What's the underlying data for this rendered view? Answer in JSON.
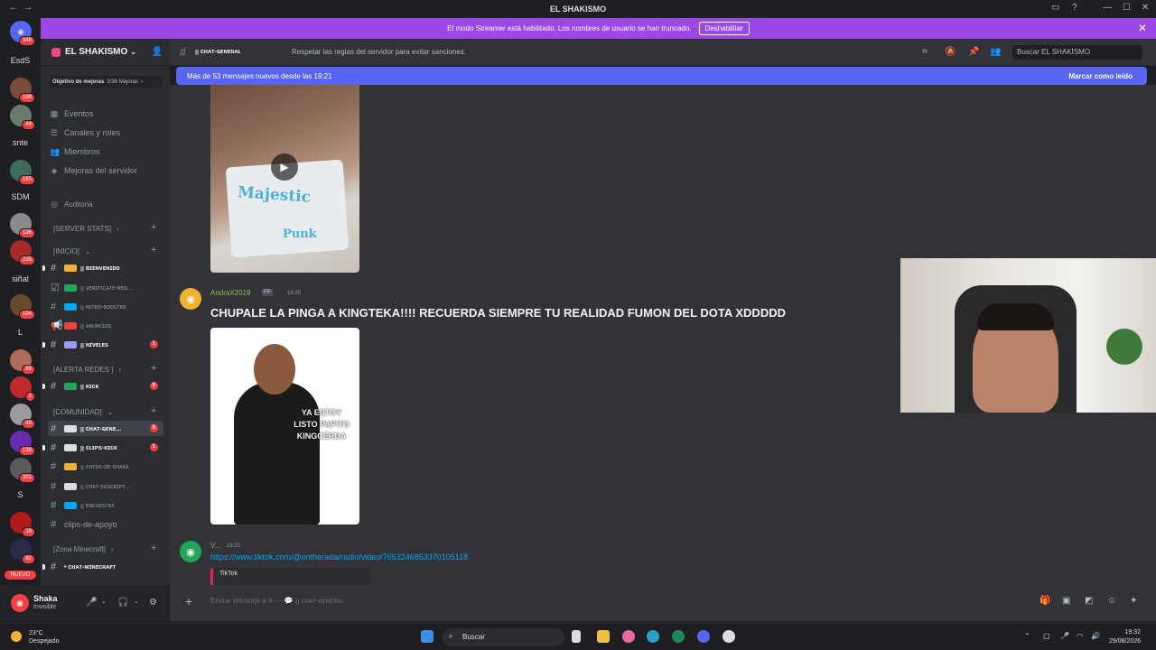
{
  "window": {
    "title": "EL SHAKISMO",
    "nav_back": "←",
    "nav_forward": "→"
  },
  "banner": {
    "text": "El modo Streamer está habilitado. Los nombres de usuario se han truncado.",
    "button": "Deshabilitar",
    "close": "✕"
  },
  "guilds": {
    "top_badge": "348",
    "items": [
      {
        "label": "EsdS",
        "badge": ""
      },
      {
        "label": "",
        "badge": "108"
      },
      {
        "label": "",
        "badge": "44"
      },
      {
        "label": "snte",
        "badge": ""
      },
      {
        "label": "",
        "badge": "165"
      },
      {
        "label": "SDM",
        "badge": ""
      },
      {
        "label": "",
        "badge": "136"
      },
      {
        "label": "",
        "badge": "235"
      },
      {
        "label": "siñal",
        "badge": ""
      },
      {
        "label": "",
        "badge": "104"
      },
      {
        "label": "L",
        "badge": ""
      },
      {
        "label": "",
        "badge": "89"
      },
      {
        "label": "",
        "badge": "2"
      },
      {
        "label": "",
        "badge": "46"
      },
      {
        "label": "",
        "badge": "138"
      },
      {
        "label": "",
        "badge": "301"
      },
      {
        "label": "S",
        "badge": ""
      },
      {
        "label": "",
        "badge": "19"
      },
      {
        "label": "",
        "badge": "82"
      }
    ],
    "new_label": "NUEVO"
  },
  "server": {
    "name": "EL SHAKISMO",
    "boost_label": "Objetivo de mejoras",
    "boost_count": "2/36 Mejoras",
    "menu": [
      "Eventos",
      "Canales y roles",
      "Miembros",
      "Mejoras del servidor"
    ],
    "audit": "Auditoria"
  },
  "categories": [
    {
      "label": "[SERVER STATS]"
    },
    {
      "label": "[INICIO]"
    },
    {
      "label": "[ALERTA REDES ]"
    },
    {
      "label": "[COMUNIDAD]"
    },
    {
      "label": "[Zona Minecraft]"
    }
  ],
  "channels": [
    {
      "label": "ꞁꞁ ʙɪᴇɴᴠᴇɴɪᴅᴏ",
      "badge": "",
      "color": "#f0b232"
    },
    {
      "label": "ꞁꞁ ᴠᴇʀɪꜰɪᴄᴀᴛᴇ-ʀᴇɢ...",
      "badge": "",
      "color": "#23a55a"
    },
    {
      "label": "ꞁꞁ ɴɪᴛʀᴏ-ʙᴏᴏsᴛᴇʀ",
      "badge": "",
      "color": "#00a8fc"
    },
    {
      "label": "ꞁꞁ ᴀɴᴜɴᴄɪᴏs",
      "badge": "",
      "color": "#f23f43"
    },
    {
      "label": "ꞁꞁ ɴɪᴠᴇʟᴇs",
      "badge": "1",
      "color": "#949cf7"
    },
    {
      "label": "ꞁꞁ ᴋɪᴄᴋ",
      "badge": "6",
      "color": "#23a55a"
    },
    {
      "label": "ꞁꞁ ᴄʜᴀᴛ-ɢᴇɴᴇ...",
      "badge": "5",
      "color": "#dbdee1"
    },
    {
      "label": "ꞁꞁ ᴄʟɪᴘs-ᴋɪᴄᴋ",
      "badge": "1",
      "color": "#dbdee1"
    },
    {
      "label": "ꞁꞁ ꜰᴏᴛᴏs-ᴅᴇ-sʜᴀᴋᴀ",
      "badge": "",
      "color": "#f0b232"
    },
    {
      "label": "ꞁꞁ ᴄʜᴀᴛ-sᴜsᴄʀɪᴘᴛ...",
      "badge": "",
      "color": "#dbdee1"
    },
    {
      "label": "ꞁꞁ ᴇɴᴄᴜᴇsᴛᴀs",
      "badge": "",
      "color": "#00a8fc"
    },
    {
      "label": "clips-de-apoyo",
      "badge": "",
      "color": ""
    },
    {
      "label": "• ᴄʜᴀᴛ-ᴍɪɴᴇᴄʀᴀꜰᴛ",
      "badge": "",
      "color": ""
    }
  ],
  "user": {
    "name": "Shaka",
    "status": "Invisible"
  },
  "channel_header": {
    "name": "ꞁꞁ ᴄʜᴀᴛ-ɢᴇɴᴇʀᴀʟ",
    "topic": "Respetar las reglas del servidor para evitar sanciones.",
    "search_placeholder": "Buscar EL SHAKISMO"
  },
  "new_messages": {
    "text": "Más de 53 mensajes nuevos desde las 19:21",
    "mark": "Marcar como leído"
  },
  "messages": [
    {
      "author": "AndraX2019",
      "role": "FP",
      "time": "19:25",
      "text": "CHUPALE LA PINGA A KINGTEKA!!!! RECUERDA SIEMPRE TU REALIDAD FUMON DEL DOTA XDDDDD",
      "image_text": "YA ESTOY LISTO PAPITO KINGCERDA"
    },
    {
      "author": "V...",
      "time": "19:25",
      "link": "https://www.tiktok.com/@ontheradarradio/video/7653246853370105118",
      "embed": "TikTok"
    }
  ],
  "video": {
    "shirt_line1": "Majestic",
    "shirt_line2": "Punk"
  },
  "composer": {
    "placeholder": "Enviar mensaje a #-----💬 ꞁꞁ ᴄʜᴀᴛ-ɢᴇɴᴇʀᴀʟ"
  },
  "taskbar": {
    "temp": "23°C",
    "weather": "Despejado",
    "search": "Buscar",
    "time": "19:32",
    "date": "29/08/2026"
  },
  "colors": {
    "accent": "#5865f2",
    "streamer_banner": "#9b48e6",
    "badge": "#f23f43"
  }
}
